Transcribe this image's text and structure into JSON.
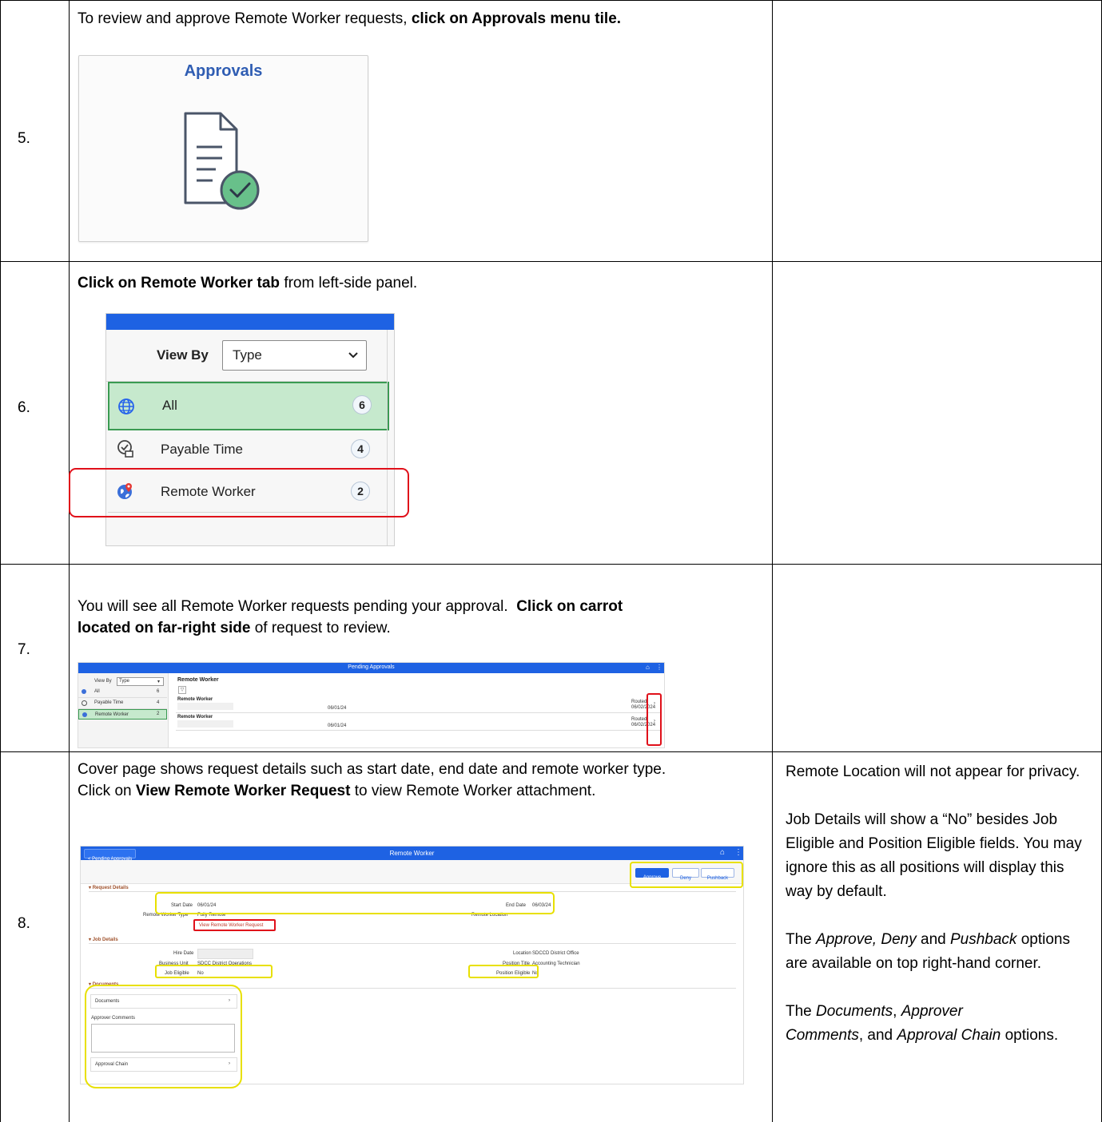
{
  "steps": [
    {
      "number": "5.",
      "text_before": "To review and approve Remote Worker requests, ",
      "text_bold": "click on Approvals menu tile.",
      "tile_title": "Approvals"
    },
    {
      "number": "6.",
      "text_bold": "Click on Remote Worker tab",
      "text_after": " from left-side panel.",
      "panel": {
        "view_by_label": "View By",
        "view_by_value": "Type",
        "items": [
          {
            "label": "All",
            "count": "6"
          },
          {
            "label": "Payable Time",
            "count": "4"
          },
          {
            "label": "Remote Worker",
            "count": "2"
          }
        ]
      }
    },
    {
      "number": "7.",
      "line1": "You will see all Remote Worker requests pending your approval.  ",
      "line1_bold": "Click on carrot",
      "line2_bold": "located on far-right side",
      "line2": " of request to review.",
      "screen": {
        "header_title": "Pending Approvals",
        "view_by_label": "View By",
        "view_by_value": "Type",
        "side_items": [
          {
            "label": "All",
            "count": "6"
          },
          {
            "label": "Payable Time",
            "count": "4"
          },
          {
            "label": "Remote Worker",
            "count": "2"
          }
        ],
        "section_title": "Remote Worker",
        "rows": [
          {
            "title": "Remote Worker",
            "date": "06/01/24",
            "status": "Routed",
            "status_date": "06/02/2024"
          },
          {
            "title": "Remote Worker",
            "date": "06/01/24",
            "status": "Routed",
            "status_date": "06/02/2024"
          }
        ]
      }
    },
    {
      "number": "8.",
      "line1": "Cover page shows request details such as start date, end date and remote worker type.",
      "line2_before": "Click on ",
      "line2_bold": "View Remote Worker Request",
      "line2_after": " to view Remote Worker attachment.",
      "screen": {
        "back_label": "< Pending Approvals",
        "header_title": "Remote Worker",
        "buttons": [
          "Approve",
          "Deny",
          "Pushback"
        ],
        "request_details_heading": "Request Details",
        "start_date_label": "Start Date",
        "start_date": "06/01/24",
        "end_date_label": "End Date",
        "end_date": "06/03/24",
        "rw_type_label": "Remote Worker Type",
        "rw_type": "Fully Remote",
        "remote_location_label": "Remote Location",
        "view_request_link": "View Remote Worker Request",
        "job_details_heading": "Job Details",
        "hire_date_label": "Hire Date",
        "location_label": "Location",
        "location": "SDCCD District Office",
        "business_unit_label": "Business Unit",
        "business_unit": "SDCC District Operations",
        "position_title_label": "Position Title",
        "position_title": "Accounting Technician",
        "job_eligible_label": "Job Eligible",
        "job_eligible": "No",
        "position_eligible_label": "Position Eligible",
        "position_eligible": "No",
        "documents_heading": "Documents",
        "documents_row": "Documents",
        "approver_comments_label": "Approver Comments",
        "approval_chain_row": "Approval Chain"
      },
      "notes": {
        "n1": "Remote Location will not appear for privacy.",
        "n2": "Job Details will show a “No” besides Job Eligible and Position Eligible fields. You may ignore this as all positions will display this way by default.",
        "n3_i1": "Approve, Deny",
        "n3_mid": " and ",
        "n3_i2": "Pushback",
        "n3_pre": "The ",
        "n3_post": " options are available on top right-hand corner.",
        "n4_pre": "The ",
        "n4_i1": "Documents",
        "n4_c1": ", ",
        "n4_i2": "Approver Comments",
        "n4_c2": ", and ",
        "n4_i3": "Approval Chain",
        "n4_post": " options."
      }
    }
  ],
  "colors": {
    "blue_header": "#1e62e3",
    "green_highlight": "#c6e9cd",
    "green_border": "#3a9a52",
    "red_annotation": "#e0101a",
    "yellow_annotation": "#e8e000",
    "tile_title": "#2f5db3",
    "icon_green": "#38a169"
  }
}
